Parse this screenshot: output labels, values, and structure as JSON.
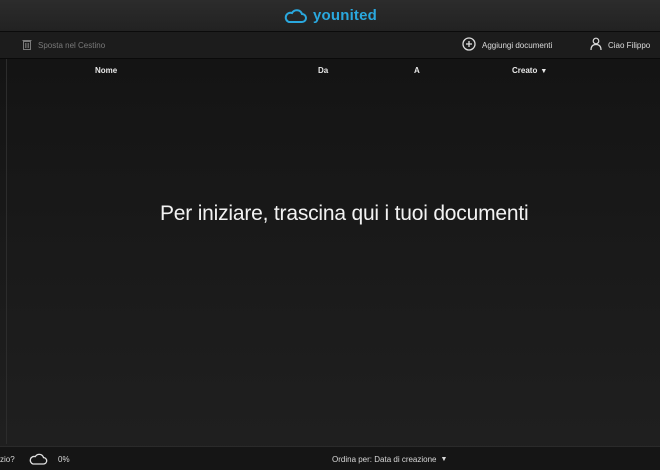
{
  "app": {
    "brand_name": "younited",
    "brand_color": "#2aa8de"
  },
  "toolbar": {
    "trash_label": "Sposta nel Cestino",
    "add_label": "Aggiungi documenti",
    "user_label": "Ciao Filippo"
  },
  "columns": {
    "name": "Nome",
    "from": "Da",
    "to": "A",
    "created": "Creato",
    "created_sort_indicator": "▼"
  },
  "dropzone": {
    "message": "Per iniziare, trascina qui i tuoi documenti"
  },
  "footer": {
    "help_fragment": "zio?",
    "storage_percent": "0%",
    "sort_label": "Ordina per: Data di creazione",
    "sort_caret": "▼"
  },
  "icons": {
    "brand": "cloud-icon",
    "trash": "trash-icon",
    "add": "plus-circle-icon",
    "user": "user-icon",
    "storage": "cloud-outline-icon"
  }
}
